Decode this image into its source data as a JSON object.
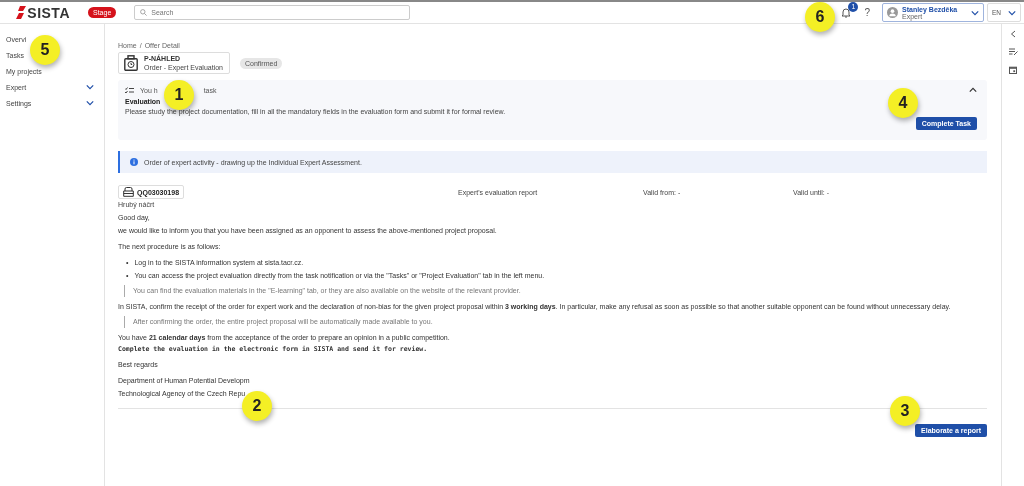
{
  "header": {
    "logo": "SISTA",
    "environment": "Stage",
    "search": {
      "placeholder": "Search"
    },
    "callout": "6",
    "notifications": "1",
    "help": "?",
    "user": {
      "name": "Stanley Bezděka",
      "role": "Expert"
    },
    "language": "EN"
  },
  "sidebar": {
    "callout": "5",
    "items": [
      {
        "label": "Overvi",
        "kind": "link"
      },
      {
        "label": "Tasks",
        "kind": "link"
      },
      {
        "label": "My projects",
        "kind": "link"
      },
      {
        "label": "Expert",
        "kind": "group"
      },
      {
        "label": "Settings",
        "kind": "group"
      }
    ]
  },
  "breadcrumb": [
    "Home",
    "/",
    "Offer Detail"
  ],
  "offer": {
    "code": "P-NÁHLED",
    "title": "Order - Expert Evaluation",
    "status": "Confirmed"
  },
  "task": {
    "header_start": "You h",
    "header_end": "task",
    "callout": "1",
    "expanded": true,
    "title": "Evaluation",
    "description": "Please study the project documentation, fill in all the mandatory fields in the evaluation form and submit it for formal review.",
    "action_callout": "4",
    "button": "Complete Task"
  },
  "info": "Order of expert activity - drawing up the Individual Expert Assessment.",
  "document": {
    "id": "QQ03030198",
    "type": "Expert's evaluation report",
    "valid_from": "Valid from: -",
    "valid_until": "Valid until: -",
    "subtitle": "Hrubý náčrt"
  },
  "body": [
    {
      "kind": "paragraph",
      "lines": [
        "Good day,",
        "we would like to inform you that you have been assigned as an opponent to assess the above-mentioned project proposal."
      ]
    },
    {
      "kind": "paragraph",
      "lines": [
        "The next procedure is as follows:"
      ]
    },
    {
      "kind": "bullets",
      "marker": "•",
      "lines": [
        "Log in to the SISTA information system at sista.tacr.cz.",
        "You can access the project evaluation directly from the task notification or via the \"Tasks\" or \"Project Evaluation\" tab in the left menu."
      ]
    },
    {
      "kind": "quote",
      "lines": [
        "You can find the evaluation materials in the \"E-learning\" tab, or they are also available on the website of the relevant provider."
      ]
    },
    {
      "kind": "paragraph",
      "lines": [
        "In SISTA, confirm the receipt of the order for expert work and the declaration of non-bias for the given project proposal within **3 working days**. In particular, make any refusal as soon as possible so that another suitable opponent can be found without unnecessary delay."
      ]
    },
    {
      "kind": "quote",
      "lines": [
        "After confirming the order, the entire project proposal will be automatically made available to you."
      ]
    },
    {
      "kind": "paragraph",
      "lines": [
        "You have **21 calendar days** from the acceptance of the order to prepare an opinion in a public competition."
      ]
    },
    {
      "kind": "code",
      "lines": [
        "Complete the evaluation in the electronic form in SISTA and send it for review."
      ]
    },
    {
      "kind": "paragraph",
      "lines": [
        "Best regards"
      ]
    },
    {
      "kind": "paragraph",
      "lines": [
        "Department of Human Potential Developm",
        "Technological Agency of the Czech Repu"
      ]
    }
  ],
  "signature_callout": "2",
  "footer": {
    "callout": "3",
    "button": "Elaborate a report"
  }
}
